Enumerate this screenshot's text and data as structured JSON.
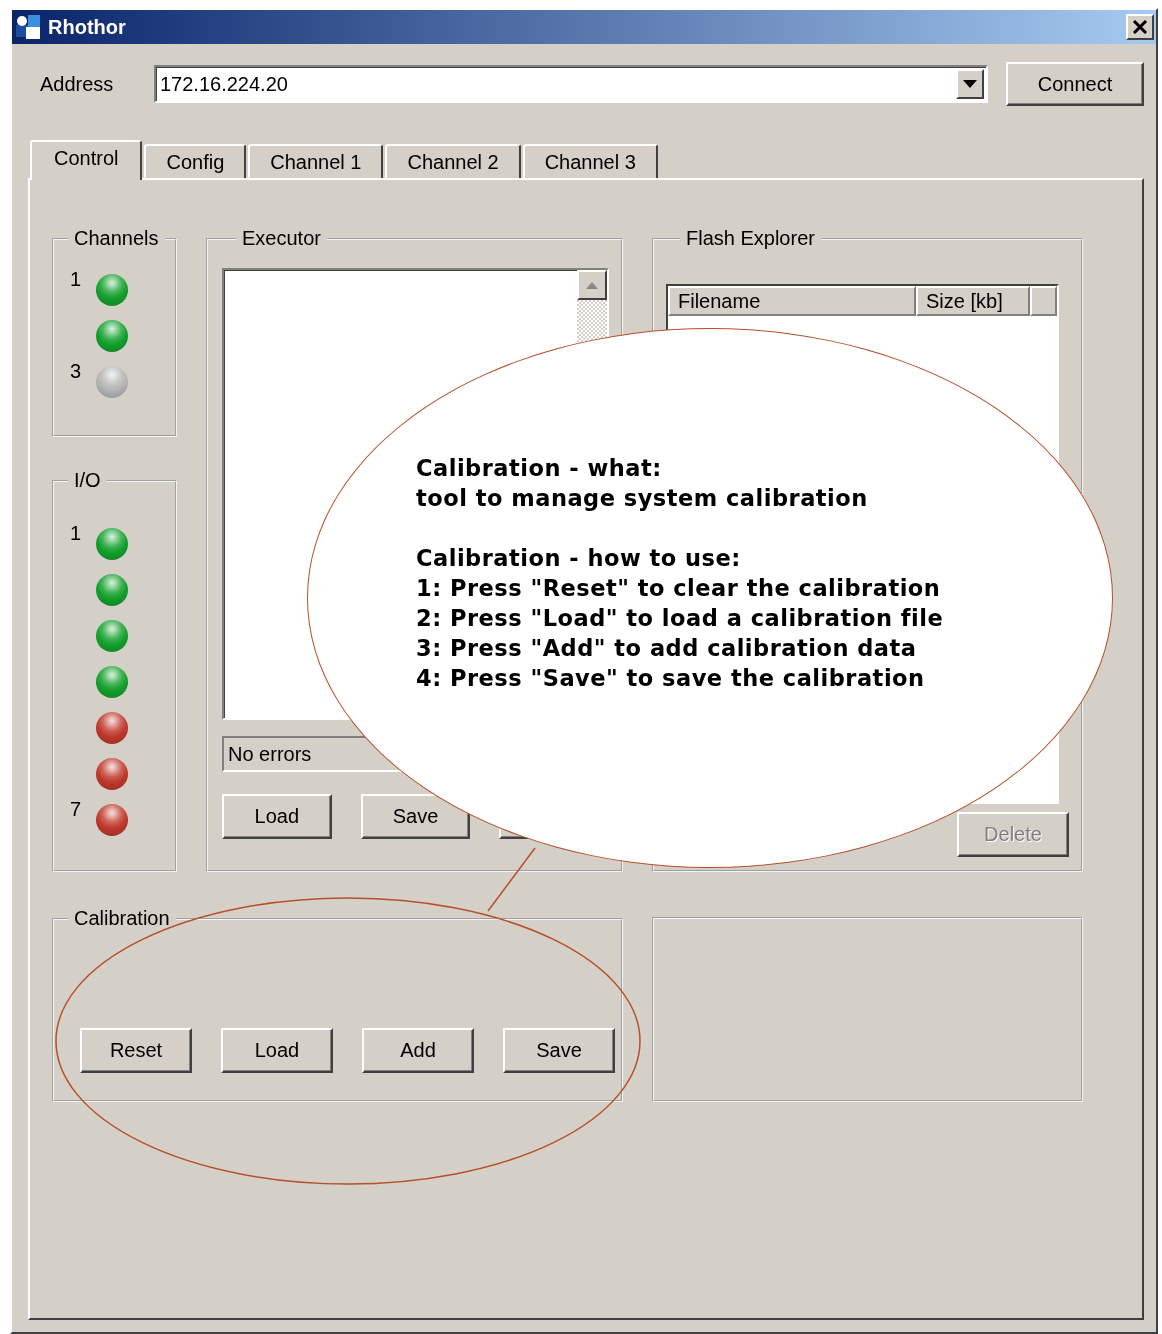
{
  "window": {
    "title": "Rhothor"
  },
  "address": {
    "label": "Address",
    "value": "172.16.224.20",
    "button": "Connect"
  },
  "tabs": [
    {
      "label": "Control",
      "selected": true
    },
    {
      "label": "Config",
      "selected": false
    },
    {
      "label": "Channel 1",
      "selected": false
    },
    {
      "label": "Channel 2",
      "selected": false
    },
    {
      "label": "Channel 3",
      "selected": false
    }
  ],
  "channels": {
    "title": "Channels",
    "leds": [
      {
        "label": "1",
        "color": "#14a02c"
      },
      {
        "color": "#14a02c"
      },
      {
        "label": "3",
        "color": "#b4b4b4"
      }
    ]
  },
  "io": {
    "title": "I/O",
    "leds": [
      {
        "label": "1",
        "color": "#14a02c"
      },
      {
        "color": "#14a02c"
      },
      {
        "color": "#14a02c"
      },
      {
        "color": "#14a02c"
      },
      {
        "color": "#c0392b"
      },
      {
        "color": "#c0392b"
      },
      {
        "label": "7",
        "color": "#c0392b"
      }
    ]
  },
  "executor": {
    "title": "Executor",
    "status": "No errors",
    "buttons": [
      {
        "label": "Load",
        "disabled": false
      },
      {
        "label": "Save",
        "disabled": false
      }
    ]
  },
  "flash_explorer": {
    "title": "Flash Explorer",
    "columns": [
      "Filename",
      "Size [kb]"
    ],
    "buttons": [
      {
        "label": "Delete",
        "disabled": true
      }
    ]
  },
  "calibration": {
    "title": "Calibration",
    "buttons": [
      {
        "label": "Reset",
        "disabled": false
      },
      {
        "label": "Load",
        "disabled": false
      },
      {
        "label": "Add",
        "disabled": false
      },
      {
        "label": "Save",
        "disabled": false
      }
    ]
  },
  "callout": {
    "paragraphs": [
      {
        "lines": [
          "Calibration - what:",
          "tool to manage system calibration"
        ]
      },
      {
        "lines": [
          "Calibration - how to use:",
          "1: Press \"Reset\" to clear the calibration",
          "2: Press \"Load\" to load a calibration file",
          "3: Press \"Add\" to add calibration data",
          "4: Press \"Save\" to save the calibration"
        ]
      }
    ]
  }
}
